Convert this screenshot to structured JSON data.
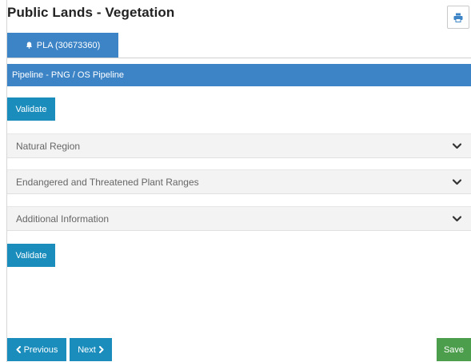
{
  "page": {
    "title": "Public Lands - Vegetation"
  },
  "toolbar": {
    "print_icon": "print-icon"
  },
  "tab": {
    "label": "PLA (30673360)",
    "icon": "bell-icon",
    "color": "#3d84c6"
  },
  "section": {
    "title": "Pipeline - PNG / OS Pipeline",
    "color": "#3d84c6"
  },
  "actions": {
    "validate_label": "Validate",
    "validate_color": "#1a8dbd"
  },
  "accordions": [
    {
      "label": "Natural Region",
      "icon": "chevron-down-icon"
    },
    {
      "label": "Endangered and Threatened Plant Ranges",
      "icon": "chevron-down-icon"
    },
    {
      "label": "Additional Information",
      "icon": "chevron-down-icon"
    }
  ],
  "footer": {
    "previous_label": "Previous",
    "next_label": "Next",
    "save_label": "Save",
    "save_color": "#4c9e4c"
  }
}
